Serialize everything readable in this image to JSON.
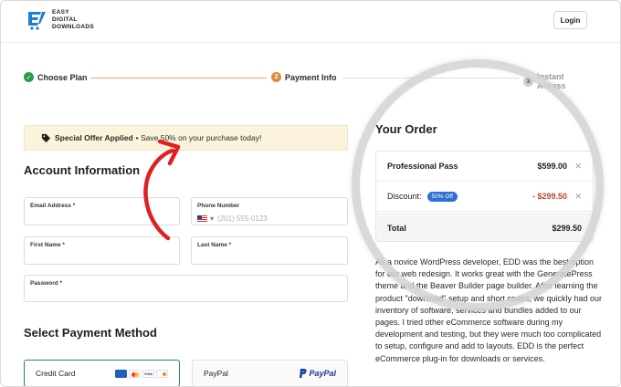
{
  "header": {
    "logo_lines": [
      "EASY",
      "DIGITAL",
      "DOWNLOADS"
    ],
    "login_label": "Login"
  },
  "steps": [
    {
      "label": "Choose Plan",
      "marker": "✓",
      "state": "done"
    },
    {
      "label": "Payment Info",
      "marker": "2",
      "state": "active"
    },
    {
      "label": "Instant Access",
      "marker": "3",
      "state": "pending"
    }
  ],
  "offer": {
    "bold": "Special Offer Applied",
    "text": "• Save 50% on your purchase today!"
  },
  "account": {
    "title": "Account Information",
    "email_label": "Email Address *",
    "phone_label": "Phone Number",
    "phone_placeholder": "(201) 555-0123",
    "first_name_label": "First Name *",
    "last_name_label": "Last Name *",
    "password_label": "Password *"
  },
  "payment": {
    "title": "Select Payment Method",
    "credit_card_label": "Credit Card",
    "paypal_label": "PayPal",
    "paypal_logo": "PayPal"
  },
  "order": {
    "title": "Your Order",
    "item_name": "Professional Pass",
    "item_price": "$599.00",
    "discount_label": "Discount:",
    "discount_badge": "50% Off",
    "discount_amount": "- $299.50",
    "total_label": "Total",
    "total_amount": "$299.50"
  },
  "testimonial": "As a novice WordPress developer, EDD was the best option for our web redesign. It works great with the GeneratePress theme and the Beaver Builder page builder. After learning the product \"download\" setup and short codes, we quickly had our inventory of software, services and bundles added to our pages. I tried other eCommerce software during my development and testing, but they were much too complicated to setup, configure and add to layouts. EDD is the perfect eCommerce plug-in for downloads or services.",
  "colors": {
    "accent_green": "#2a8a3e",
    "step_active": "#e08a3c",
    "badge_blue": "#2f6fd6",
    "discount_red": "#b5473a",
    "arrow_red": "#e02020",
    "offer_bg": "#fbf3dc"
  }
}
